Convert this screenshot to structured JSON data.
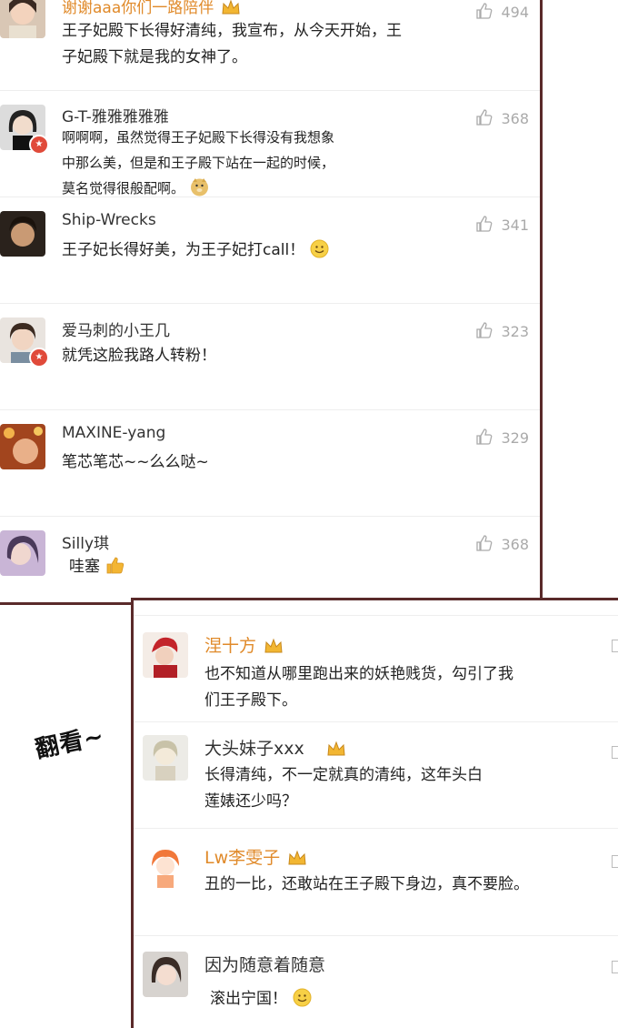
{
  "top_comments": [
    {
      "name": "谢谢aaa你们一路陪伴",
      "likes": "494",
      "text": "王子妃殿下长得好清纯，我宣布，从今天开始，王子妃殿下就是我的女神了。"
    },
    {
      "name": "G-T-雅雅雅雅雅",
      "likes": "368",
      "text": "啊啊啊，虽然觉得王子妃殿下长得没有我想象中那么美，但是和王子殿下站在一起的时候，莫名觉得很般配啊。"
    },
    {
      "name": "Ship-Wrecks",
      "likes": "341",
      "text": "王子妃长得好美，为王子妃打call！"
    },
    {
      "name": "爱马刺的小王几",
      "likes": "323",
      "text": "就凭这脸我路人转粉！"
    },
    {
      "name": "MAXINE-yang",
      "likes": "329",
      "text": "笔芯笔芯~~么么哒~"
    },
    {
      "name": "Silly琪",
      "likes": "368",
      "text": "哇塞"
    }
  ],
  "caption": "翻看~",
  "bottom_comments": [
    {
      "name": "涅十方",
      "text": "也不知道从哪里跑出来的妖艳贱货，勾引了我们王子殿下。"
    },
    {
      "name": "大头妹子xxx",
      "text": "长得清纯，不一定就真的清纯，这年头白莲婊还少吗？"
    },
    {
      "name": "Lw李雯子",
      "text": "丑的一比，还敢站在王子殿下身边，真不要脸。"
    },
    {
      "name": "因为随意着随意",
      "text": "滚出宁国！"
    }
  ],
  "icons": {
    "like": "thumbs-up-icon",
    "verified": "verified-badge-icon",
    "crown": "crown-icon",
    "smile": "smile-emoji-icon",
    "thumb": "thumbs-up-emoji-icon",
    "doge": "doge-emoji-icon"
  },
  "colors": {
    "frame": "#5a2a2a",
    "vip_name": "#e08a2a",
    "verified": "#e04a3a",
    "like_gray": "#aaaaaa"
  }
}
